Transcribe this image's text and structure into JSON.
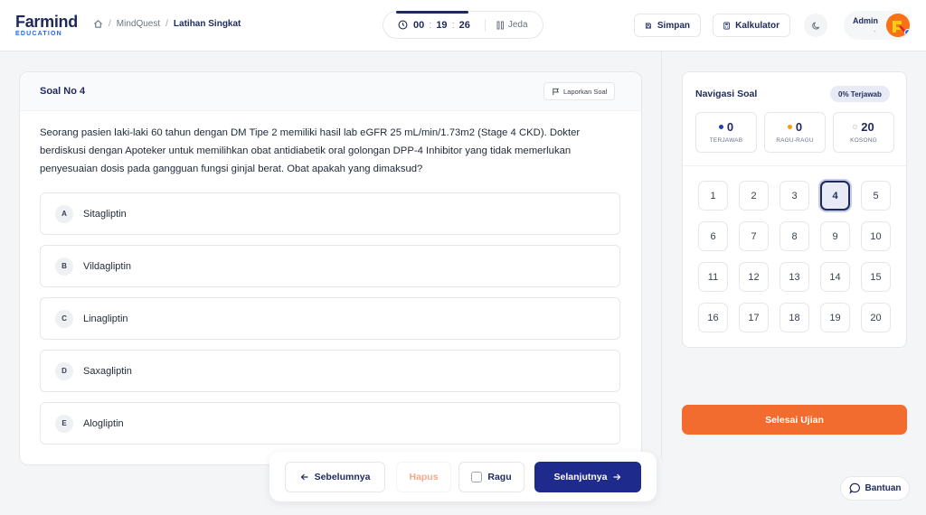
{
  "header": {
    "brand": "Farmind",
    "brand_sub": "EDUCATION",
    "breadcrumb": [
      "MindQuest",
      "Latihan Singkat"
    ],
    "timer": {
      "hours": "00",
      "minutes": "19",
      "seconds": "26",
      "pause_label": "Jeda",
      "elapsed_fraction": 0.45
    },
    "save_label": "Simpan",
    "calculator_label": "Kalkulator",
    "user": {
      "name": "Admin",
      "role": "-"
    }
  },
  "question": {
    "title": "Soal No 4",
    "report_label": "Laporkan Soal",
    "text": "Seorang pasien laki-laki 60 tahun dengan DM Tipe 2 memiliki hasil lab eGFR 25 mL/min/1.73m2 (Stage 4 CKD). Dokter berdiskusi dengan Apoteker untuk memilihkan obat antidiabetik oral golongan DPP-4 Inhibitor yang tidak memerlukan penyesuaian dosis pada gangguan fungsi ginjal berat. Obat apakah yang dimaksud?",
    "options": [
      {
        "letter": "A",
        "text": "Sitagliptin"
      },
      {
        "letter": "B",
        "text": "Vildagliptin"
      },
      {
        "letter": "C",
        "text": "Linagliptin"
      },
      {
        "letter": "D",
        "text": "Saxagliptin"
      },
      {
        "letter": "E",
        "text": "Alogliptin"
      }
    ]
  },
  "navigation": {
    "title": "Navigasi Soal",
    "progress_label": "0% Terjawab",
    "stats": [
      {
        "value": "0",
        "label": "TERJAWAB",
        "color": "#1e40af"
      },
      {
        "value": "0",
        "label": "RAGU-RAGU",
        "color": "#f59e0b"
      },
      {
        "value": "20",
        "label": "KOSONG",
        "color": "#d1d5db"
      }
    ],
    "numbers": [
      "1",
      "2",
      "3",
      "4",
      "5",
      "6",
      "7",
      "8",
      "9",
      "10",
      "11",
      "12",
      "13",
      "14",
      "15",
      "16",
      "17",
      "18",
      "19",
      "20"
    ],
    "active": "4",
    "finish_label": "Selesai Ujian"
  },
  "actions": {
    "prev_label": "Sebelumnya",
    "delete_label": "Hapus",
    "doubt_label": "Ragu",
    "next_label": "Selanjutnya"
  },
  "help_label": "Bantuan",
  "colors": {
    "primary": "#1e2a8c",
    "accent": "#f26b2f",
    "navy": "#1e2a5a"
  }
}
